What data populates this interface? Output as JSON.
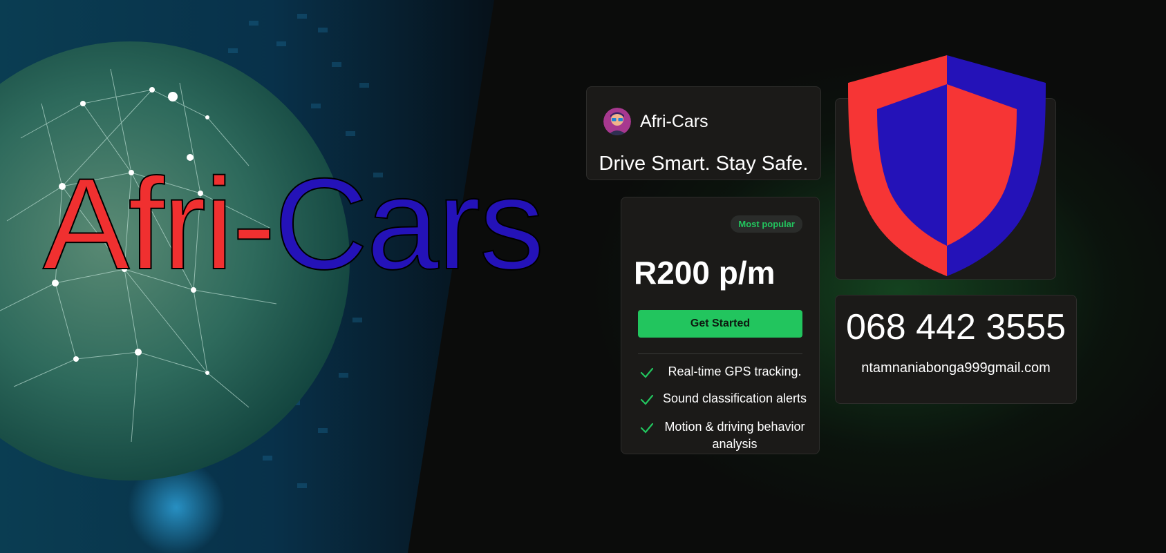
{
  "hero": {
    "title_part1": "Afri-",
    "title_part2": "Cars"
  },
  "brand_card": {
    "name": "Afri-Cars",
    "tagline": "Drive Smart. Stay Safe."
  },
  "pricing": {
    "badge": "Most popular",
    "price": "R200 p/m",
    "cta": "Get Started",
    "features": [
      "Real-time GPS tracking.",
      "Sound classification alerts",
      "Motion & driving behavior analysis"
    ]
  },
  "contact": {
    "phone": "068 442 3555",
    "email": "ntamnaniabonga999gmail.com"
  },
  "colors": {
    "accent_green": "#22c55e",
    "shield_red": "#f63535",
    "shield_blue": "#2412b8",
    "title_red": "#f03030",
    "title_blue": "#2412b8"
  },
  "icons": [
    "avatar",
    "check-icon",
    "shield-icon"
  ]
}
